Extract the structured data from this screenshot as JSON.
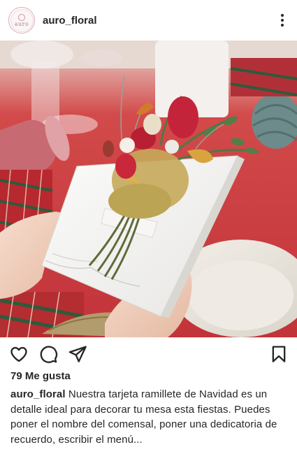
{
  "post": {
    "username": "auro_floral",
    "avatar_text": "auro",
    "likes_text": "79 Me gusta",
    "caption_user": "auro_floral",
    "caption_text": "Nuestra tarjeta ramillete de Navidad es un detalle ideal para decorar tu mesa esta fiestas. Puedes poner el nombre del comensal, poner una dedicatoria de recuerdo, escribir el menú..."
  },
  "icons": {
    "more": "more-vertical-icon",
    "like": "heart-icon",
    "comment": "comment-icon",
    "share": "send-icon",
    "save": "bookmark-icon"
  },
  "colors": {
    "text": "#262626",
    "tablecloth": "#c93a3c",
    "card": "#f4f3f1"
  }
}
